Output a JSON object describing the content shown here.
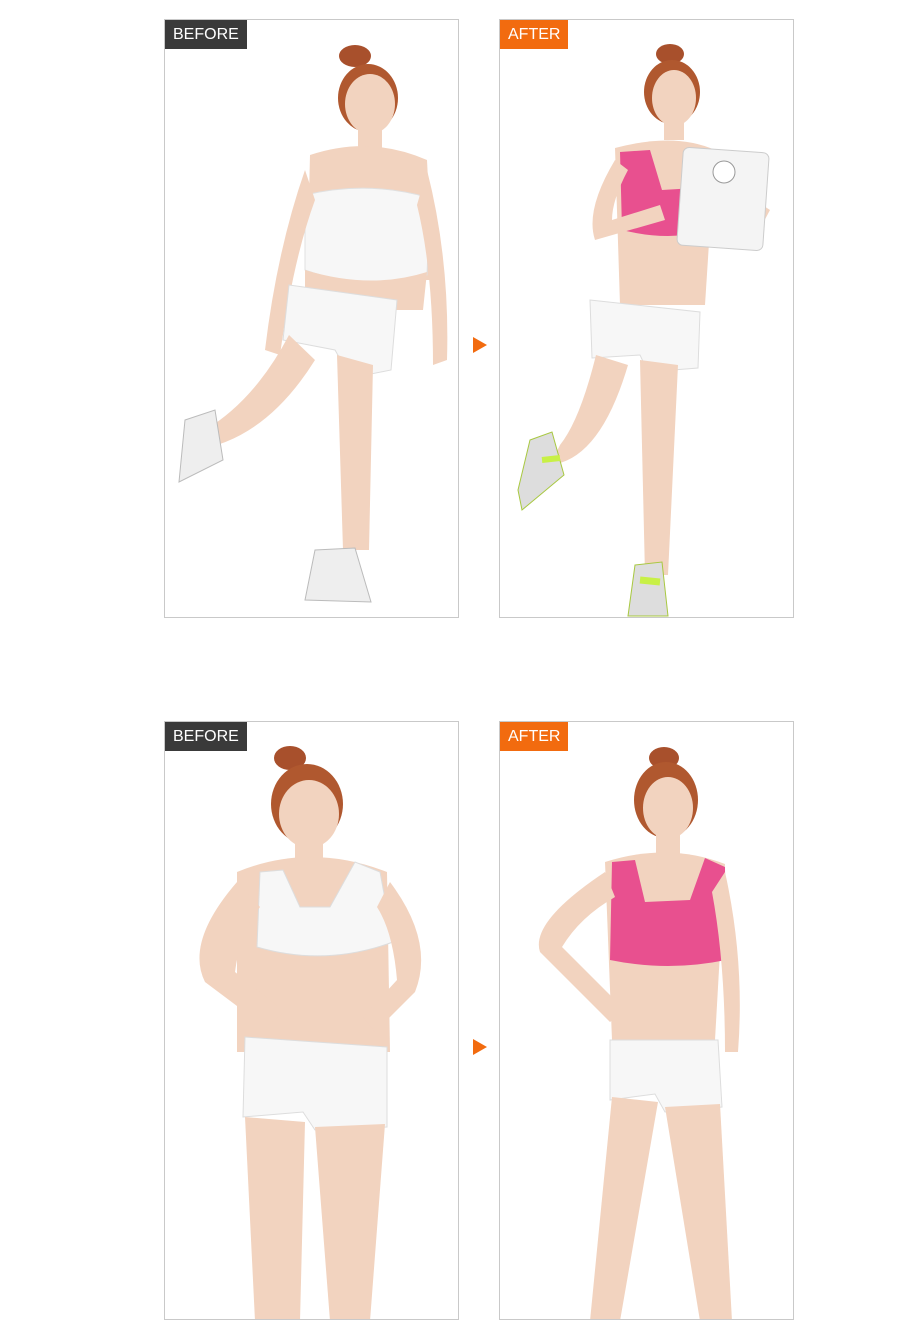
{
  "pairs": [
    {
      "before": {
        "label": "BEFORE"
      },
      "after": {
        "label": "AFTER"
      }
    },
    {
      "before": {
        "label": "BEFORE"
      },
      "after": {
        "label": "AFTER"
      }
    }
  ],
  "colors": {
    "before_tag": "#3a3a3a",
    "after_tag": "#f26b0f",
    "arrow": "#f26b0f",
    "frame_border": "#c9c9c9",
    "skin": "#f2d3bf",
    "hair": "#a8502c",
    "white_garment": "#f7f7f7",
    "pink_top": "#e8508f",
    "neon_shoe": "#c8f046"
  },
  "icons": [
    "arrow-right-icon",
    "bathroom-scale-icon"
  ]
}
